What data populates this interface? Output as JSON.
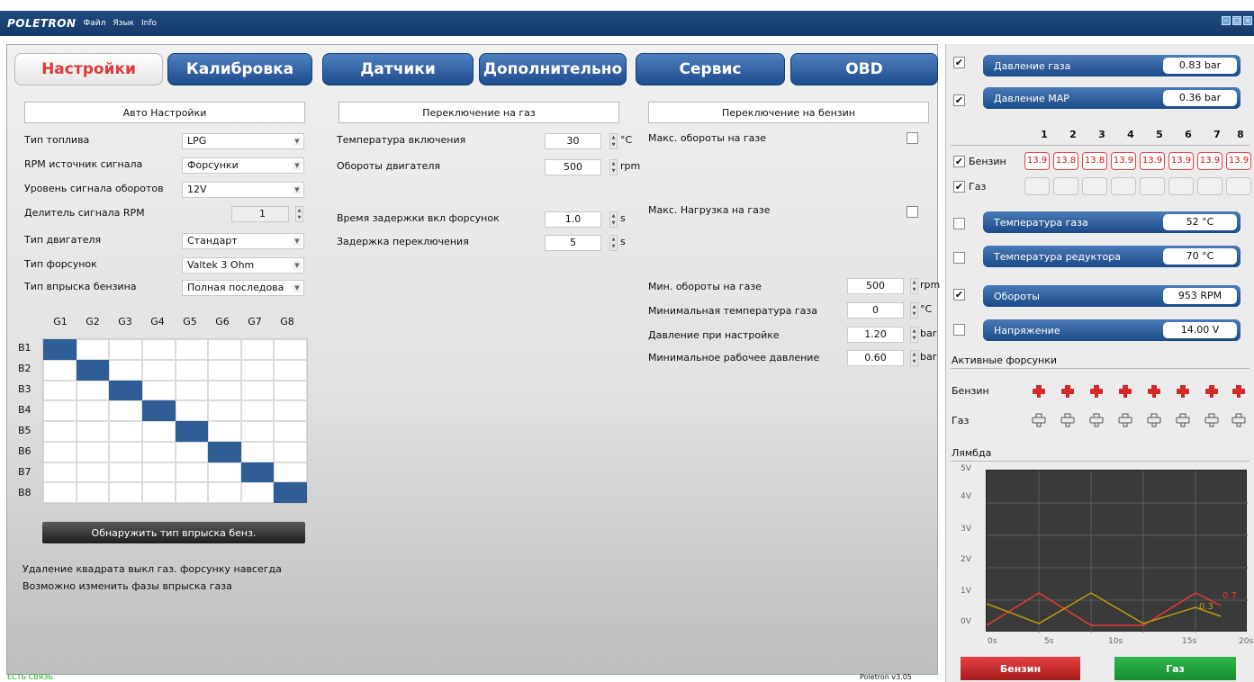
{
  "app": {
    "logo": "POLETRON",
    "menus": [
      "Файл",
      "Язык",
      "Info"
    ]
  },
  "tabs": [
    "Настройки",
    "Калибровка",
    "Датчики",
    "Дополнительно",
    "Сервис",
    "OBD"
  ],
  "sections": {
    "auto": "Авто Настройки",
    "to_gas": "Переключение на газ",
    "to_petrol": "Переключение на бензин"
  },
  "auto": {
    "fuel_type": {
      "label": "Тип топлива",
      "value": "LPG"
    },
    "rpm_source": {
      "label": "RPM источник сигнала",
      "value": "Форсунки"
    },
    "rpm_level": {
      "label": "Уровень сигнала оборотов",
      "value": "12V"
    },
    "rpm_divider": {
      "label": "Делитель сигнала RPM",
      "value": "1"
    },
    "engine_type": {
      "label": "Тип двигателя",
      "value": "Стандарт"
    },
    "injector_type": {
      "label": "Тип форсунок",
      "value": "Valtek 3 Ohm"
    },
    "petrol_injection": {
      "label": "Тип впрыска бензина",
      "value": "Полная последова"
    }
  },
  "grid": {
    "cols": [
      "G1",
      "G2",
      "G3",
      "G4",
      "G5",
      "G6",
      "G7",
      "G8"
    ],
    "rows": [
      "B1",
      "B2",
      "B3",
      "B4",
      "B5",
      "B6",
      "B7",
      "B8"
    ]
  },
  "detect_button": "Обнаружить тип впрыска бенз.",
  "notes": [
    "Удаление квадрата выкл газ. форсунку навсегда",
    "Возможно изменить фазы впрыска газа"
  ],
  "to_gas": {
    "temp": {
      "label": "Температура включения",
      "value": "30",
      "unit": "°C"
    },
    "rpm": {
      "label": "Обороты двигателя",
      "value": "500",
      "unit": "rpm"
    },
    "delay_inj": {
      "label": "Время задержки вкл форсунок",
      "value": "1.0",
      "unit": "s"
    },
    "delay_switch": {
      "label": "Задержка переключения",
      "value": "5",
      "unit": "s"
    }
  },
  "to_petrol": {
    "max_rpm": {
      "label": "Макс. обороты на газе"
    },
    "max_load": {
      "label": "Макс. Нагрузка на газе"
    },
    "min_rpm": {
      "label": "Мин. обороты на газе",
      "value": "500",
      "unit": "rpm"
    },
    "min_temp": {
      "label": "Минимальная температура газа",
      "value": "0",
      "unit": "°C"
    },
    "pressure_setup": {
      "label": "Давление при настройке",
      "value": "1.20",
      "unit": "bar"
    },
    "min_pressure": {
      "label": "Минимальное рабочее давление",
      "value": "0.60",
      "unit": "bar"
    }
  },
  "status": {
    "left": "ЕСТЬ СВЯЗЬ",
    "version": "Poletron v3.05"
  },
  "sensors": [
    {
      "label": "Давление газа",
      "value": "0.83 bar",
      "checked": true
    },
    {
      "label": "Давление MAP",
      "value": "0.36 bar",
      "checked": true
    },
    {
      "label": "Температура газа",
      "value": "52 °C",
      "checked": false
    },
    {
      "label": "Температура редуктора",
      "value": "70 °C",
      "checked": false
    },
    {
      "label": "Обороты",
      "value": "953 RPM",
      "checked": true
    },
    {
      "label": "Напряжение",
      "value": "14.00 V",
      "checked": false
    }
  ],
  "injection_times": {
    "numbers": [
      "1",
      "2",
      "3",
      "4",
      "5",
      "6",
      "7",
      "8"
    ],
    "petrol_label": "Бензин",
    "gas_label": "Газ",
    "petrol": [
      "13.9",
      "13.8",
      "13.8",
      "13.9",
      "13.9",
      "13.9",
      "13.9",
      "13.9"
    ]
  },
  "active_injectors": {
    "title": "Активные форсунки",
    "petrol": "Бензин",
    "gas": "Газ"
  },
  "lambda": {
    "title": "Лямбда",
    "y_ticks": [
      "5V",
      "4V",
      "3V",
      "2V",
      "1V",
      "0V"
    ],
    "x_ticks": [
      "0s",
      "5s",
      "10s",
      "15s",
      "20s"
    ],
    "red_value": "0.7",
    "yellow_value": "0.3"
  },
  "buttons": {
    "petrol": "Бензин",
    "gas": "Газ"
  },
  "colors": {
    "accent": "#1c4c8d",
    "red": "#d62828",
    "green": "#1f9e38"
  }
}
